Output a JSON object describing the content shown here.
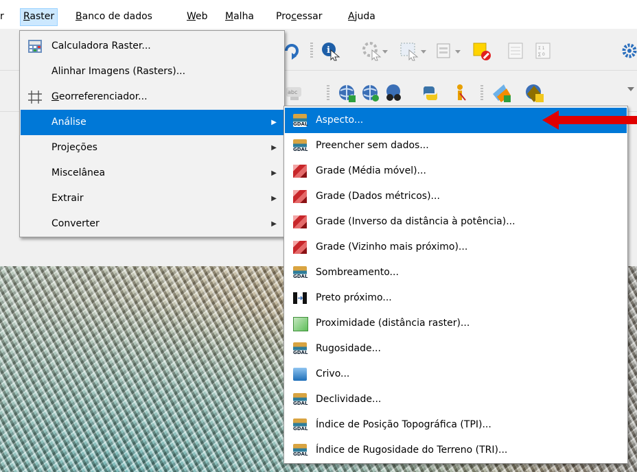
{
  "menubar": {
    "items": [
      {
        "label": "r",
        "mnemonic": ""
      },
      {
        "pre": "",
        "mn": "R",
        "post": "aster"
      },
      {
        "pre": "",
        "mn": "B",
        "post": "anco de dados"
      },
      {
        "pre": "",
        "mn": "W",
        "post": "eb"
      },
      {
        "pre": "",
        "mn": "M",
        "post": "alha"
      },
      {
        "pre": "Pro",
        "mn": "c",
        "post": "essar"
      },
      {
        "pre": "",
        "mn": "A",
        "post": "juda"
      }
    ]
  },
  "raster_menu": {
    "items": [
      {
        "label": "Calculadora Raster...",
        "icon": "raster-calculator-icon"
      },
      {
        "label": "Alinhar Imagens (Rasters)...",
        "icon": ""
      },
      {
        "pre": "",
        "mn": "G",
        "post": "eorreferenciador...",
        "icon": "georeferencer-icon"
      },
      {
        "label": "Análise",
        "submenu": true,
        "highlighted": true
      },
      {
        "label": "Projeções",
        "submenu": true
      },
      {
        "label": "Miscelânea",
        "submenu": true
      },
      {
        "label": "Extrair",
        "submenu": true
      },
      {
        "label": "Converter",
        "submenu": true
      }
    ]
  },
  "analysis_menu": {
    "items": [
      {
        "label": "Aspecto...",
        "icon": "gdal",
        "highlighted": true
      },
      {
        "label": "Preencher sem dados...",
        "icon": "gdal"
      },
      {
        "label": "Grade (Média móvel)...",
        "icon": "grid"
      },
      {
        "label": "Grade (Dados métricos)...",
        "icon": "grid"
      },
      {
        "label": "Grade (Inverso da distância à potência)...",
        "icon": "grid"
      },
      {
        "label": "Grade (Vizinho mais próximo)...",
        "icon": "grid"
      },
      {
        "label": "Sombreamento...",
        "icon": "gdal"
      },
      {
        "label": "Preto próximo...",
        "icon": "nearblack"
      },
      {
        "label": "Proximidade (distância raster)...",
        "icon": "proximity"
      },
      {
        "label": "Rugosidade...",
        "icon": "gdal"
      },
      {
        "label": "Crivo...",
        "icon": "sieve"
      },
      {
        "label": "Declividade...",
        "icon": "gdal"
      },
      {
        "label": "Índice de Posição Topográfica (TPI)...",
        "icon": "gdal"
      },
      {
        "label": "Índice de Rugosidade do Terreno (TRI)...",
        "icon": "gdal"
      }
    ]
  },
  "gdal_text": "GDAL",
  "colors": {
    "highlight": "#0078d7",
    "arrow": "#e00000"
  }
}
